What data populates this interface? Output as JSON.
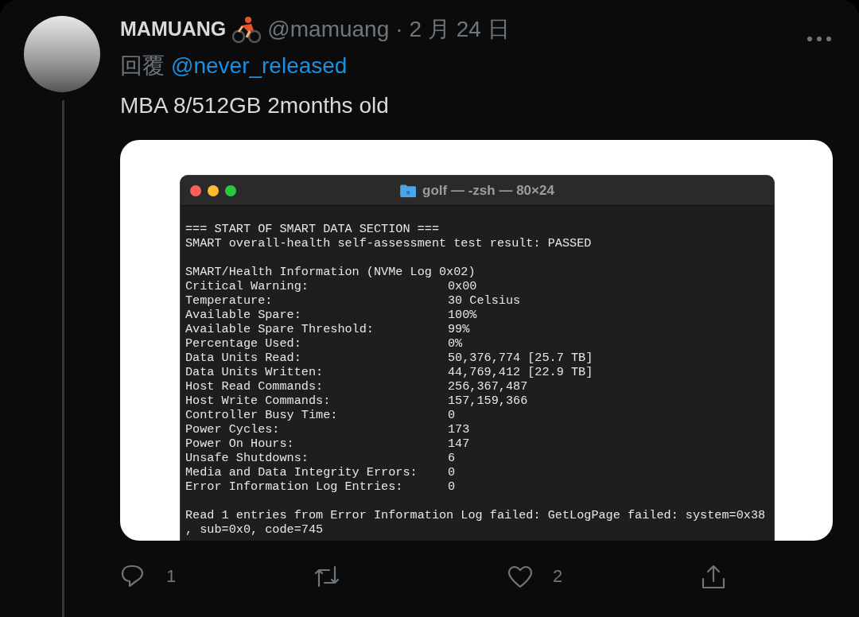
{
  "tweet": {
    "display_name": "MAMUANG",
    "handle": "@mamuang",
    "separator": "·",
    "date": "2 月 24 日",
    "reply_label": "回覆",
    "reply_to": "@never_released",
    "text": "MBA 8/512GB 2months old"
  },
  "terminal": {
    "title": "golf — -zsh — 80×24",
    "lines": [
      {
        "kind": "gap"
      },
      {
        "kind": "text",
        "text": "=== START OF SMART DATA SECTION ==="
      },
      {
        "kind": "text",
        "text": "SMART overall-health self-assessment test result: PASSED"
      },
      {
        "kind": "gap"
      },
      {
        "kind": "text",
        "text": "SMART/Health Information (NVMe Log 0x02)"
      },
      {
        "kind": "field",
        "key": "Critical Warning:",
        "value": "0x00"
      },
      {
        "kind": "field",
        "key": "Temperature:",
        "value": "30 Celsius"
      },
      {
        "kind": "field",
        "key": "Available Spare:",
        "value": "100%"
      },
      {
        "kind": "field",
        "key": "Available Spare Threshold:",
        "value": "99%"
      },
      {
        "kind": "field",
        "key": "Percentage Used:",
        "value": "0%"
      },
      {
        "kind": "field",
        "key": "Data Units Read:",
        "value": "50,376,774 [25.7 TB]"
      },
      {
        "kind": "field",
        "key": "Data Units Written:",
        "value": "44,769,412 [22.9 TB]"
      },
      {
        "kind": "field",
        "key": "Host Read Commands:",
        "value": "256,367,487"
      },
      {
        "kind": "field",
        "key": "Host Write Commands:",
        "value": "157,159,366"
      },
      {
        "kind": "field",
        "key": "Controller Busy Time:",
        "value": "0"
      },
      {
        "kind": "field",
        "key": "Power Cycles:",
        "value": "173"
      },
      {
        "kind": "field",
        "key": "Power On Hours:",
        "value": "147"
      },
      {
        "kind": "field",
        "key": "Unsafe Shutdowns:",
        "value": "6"
      },
      {
        "kind": "field",
        "key": "Media and Data Integrity Errors:",
        "value": "0"
      },
      {
        "kind": "field",
        "key": "Error Information Log Entries:",
        "value": "0"
      },
      {
        "kind": "gap"
      },
      {
        "kind": "text",
        "text": "Read 1 entries from Error Information Log failed: GetLogPage failed: system=0x38"
      },
      {
        "kind": "text",
        "text": ", sub=0x0, code=745"
      }
    ]
  },
  "actions": [
    {
      "kind": "reply",
      "count": "1"
    },
    {
      "kind": "retweet"
    },
    {
      "kind": "like",
      "count": "2"
    },
    {
      "kind": "share"
    }
  ]
}
